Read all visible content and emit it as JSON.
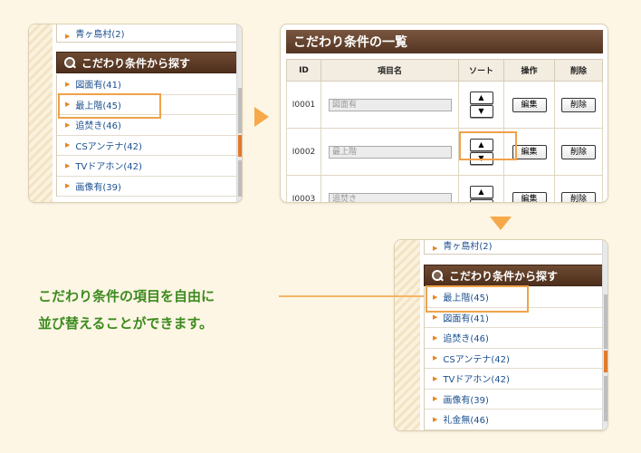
{
  "sidebar_before": {
    "top_item": "青ヶ島村(2)",
    "heading": "こだわり条件から探す",
    "items": [
      {
        "label": "図面有(41)"
      },
      {
        "label": "最上階(45)"
      },
      {
        "label": "追焚き(46)"
      },
      {
        "label": "CSアンテナ(42)"
      },
      {
        "label": "TVドアホン(42)"
      },
      {
        "label": "画像有(39)"
      }
    ]
  },
  "table_panel": {
    "title": "こだわり条件の一覧",
    "headers": {
      "id": "ID",
      "name": "項目名",
      "sort": "ソート",
      "op": "操作",
      "del": "削除"
    },
    "rows": [
      {
        "id": "I0001",
        "name": "図面有"
      },
      {
        "id": "I0002",
        "name": "最上階"
      },
      {
        "id": "I0003",
        "name": "追焚き"
      }
    ],
    "up_symbol": "▲",
    "down_symbol": "▼",
    "edit_label": "編集",
    "delete_label": "削除"
  },
  "sidebar_after": {
    "top_item": "青ヶ島村(2)",
    "heading": "こだわり条件から探す",
    "items": [
      {
        "label": "最上階(45)"
      },
      {
        "label": "図面有(41)"
      },
      {
        "label": "追焚き(46)"
      },
      {
        "label": "CSアンテナ(42)"
      },
      {
        "label": "TVドアホン(42)"
      },
      {
        "label": "画像有(39)"
      },
      {
        "label": "礼金無(46)"
      }
    ]
  },
  "caption": {
    "line1": "こだわり条件の項目を自由に",
    "line2": "並び替えることができます。"
  },
  "colors": {
    "background": "#fdf6e4",
    "heading_brown": "#5a3a24",
    "highlight_orange": "#f0a24a",
    "arrow_orange": "#f6a94a",
    "caption_green": "#3c8a1f",
    "link_blue": "#1b4f8f"
  },
  "icons": {
    "heading_icon": "magnifier-icon",
    "list_bullet": "orange-arrow-icon",
    "flow_arrows": [
      "arrow-right-icon",
      "arrow-down-icon"
    ]
  }
}
